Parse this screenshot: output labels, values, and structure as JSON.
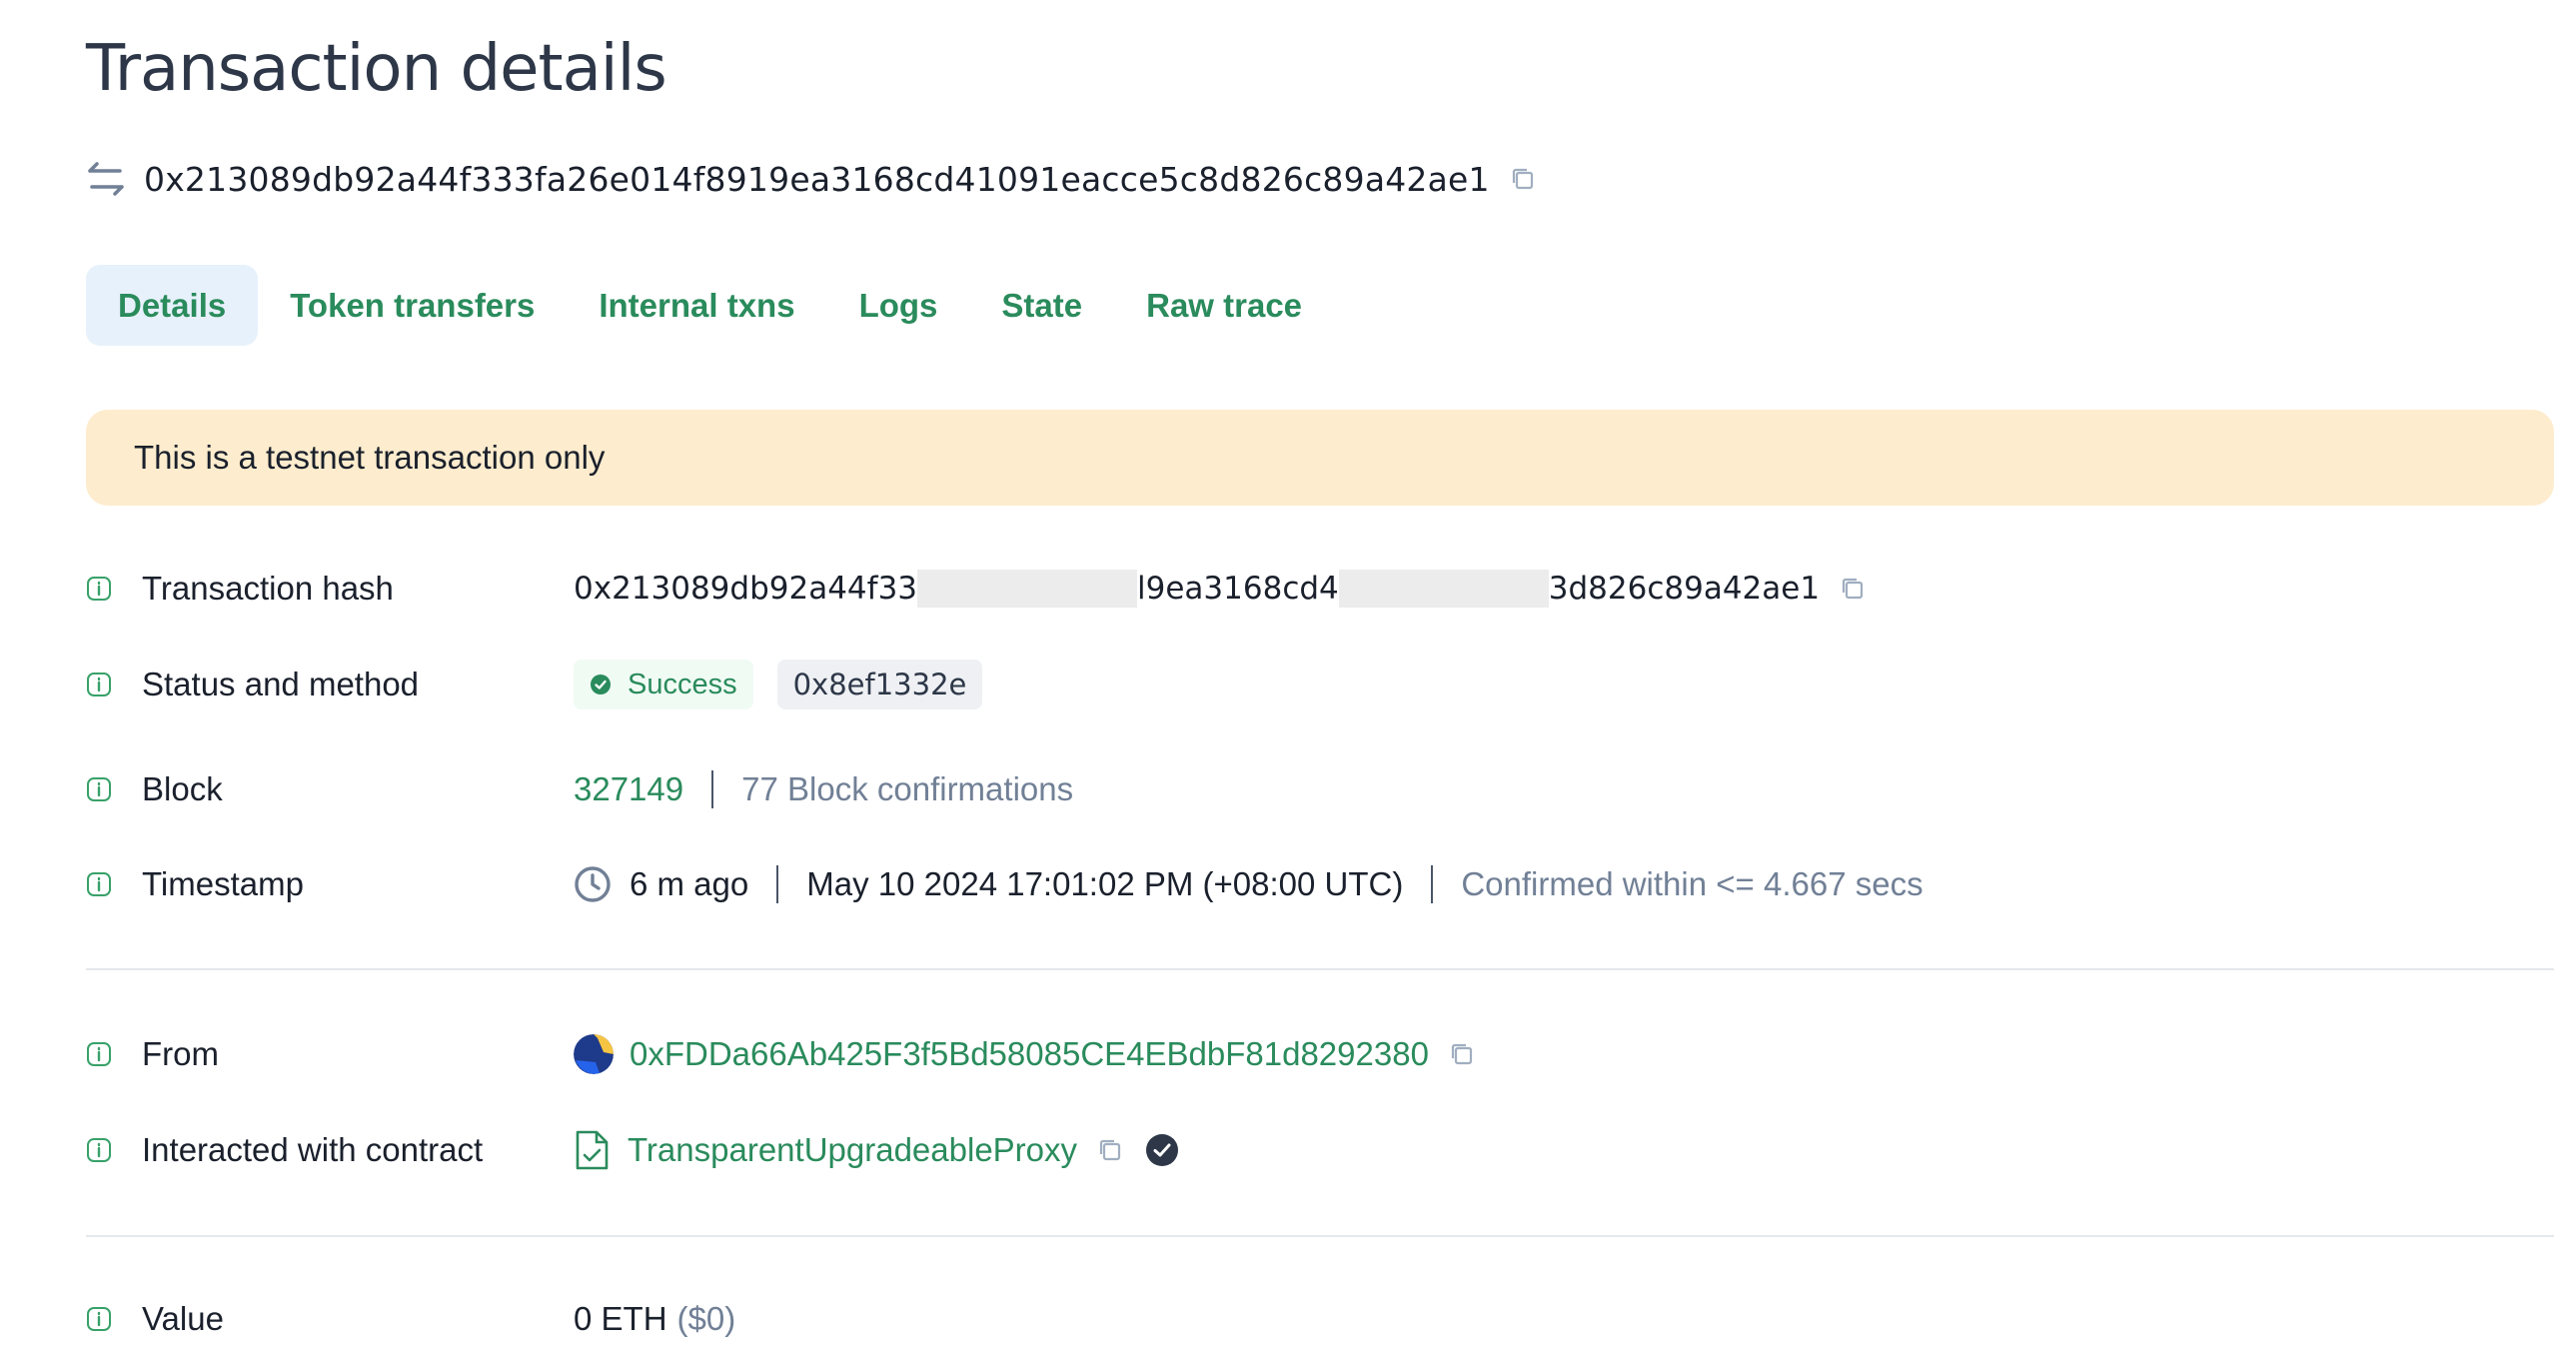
{
  "page_title": "Transaction details",
  "header": {
    "hash": "0x213089db92a44f333fa26e014f8919ea3168cd41091eacce5c8d826c89a42ae1"
  },
  "tabs": [
    {
      "label": "Details",
      "active": true
    },
    {
      "label": "Token transfers",
      "active": false
    },
    {
      "label": "Internal txns",
      "active": false
    },
    {
      "label": "Logs",
      "active": false
    },
    {
      "label": "State",
      "active": false
    },
    {
      "label": "Raw trace",
      "active": false
    }
  ],
  "banner": {
    "text": "This is a testnet transaction only"
  },
  "details": {
    "tx_hash": {
      "label": "Transaction hash",
      "part1": "0x213089db92a44f33",
      "part2": "l9ea3168cd4",
      "part3": "3d826c89a42ae1"
    },
    "status": {
      "label": "Status and method",
      "status_text": "Success",
      "method": "0x8ef1332e"
    },
    "block": {
      "label": "Block",
      "number": "327149",
      "confirmations": "77 Block confirmations"
    },
    "timestamp": {
      "label": "Timestamp",
      "ago": "6 m ago",
      "datetime": "May 10 2024 17:01:02 PM (+08:00 UTC)",
      "confirmed": "Confirmed within <= 4.667 secs"
    },
    "from": {
      "label": "From",
      "address": "0xFDDa66Ab425F3f5Bd58085CE4EBdbF81d8292380"
    },
    "contract": {
      "label": "Interacted with contract",
      "name": "TransparentUpgradeableProxy"
    },
    "value": {
      "label": "Value",
      "amount": "0 ETH",
      "usd": "($0)"
    }
  },
  "colors": {
    "accent": "#2a8b5c",
    "tab_active_bg": "#e7f1fb",
    "banner_bg": "#fdeccd",
    "muted": "#718096"
  },
  "icons": {
    "header": "swap-arrows-icon",
    "copy": "copy-icon",
    "info": "info-icon",
    "success": "check-circle-icon",
    "clock": "clock-icon",
    "contract": "document-check-icon",
    "verified": "verified-badge-icon"
  }
}
